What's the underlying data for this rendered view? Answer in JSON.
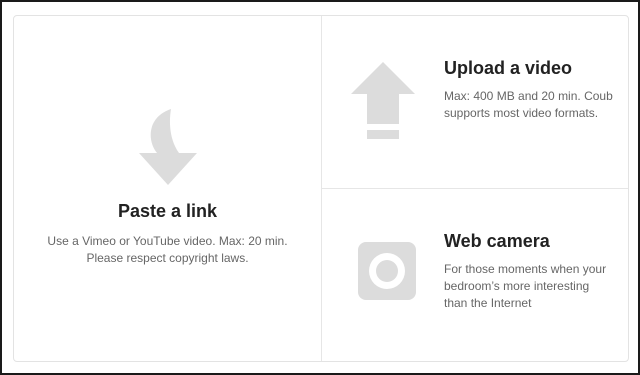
{
  "paste": {
    "title": "Paste a link",
    "description": "Use a Vimeo or YouTube video. Max: 20 min. Please respect copyright laws.",
    "icon": "curved-down-arrow-icon"
  },
  "upload": {
    "title": "Upload a video",
    "description": "Max: 400 MB and 20 min. Coub supports most video formats.",
    "icon": "upload-arrow-icon"
  },
  "camera": {
    "title": "Web camera",
    "description": "For those moments when your bedroom’s more interesting than the Internet",
    "icon": "web-camera-icon"
  },
  "colors": {
    "icon": "#dcdcdc",
    "title": "#222222",
    "text": "#666666",
    "divider": "#e6e6e6"
  }
}
